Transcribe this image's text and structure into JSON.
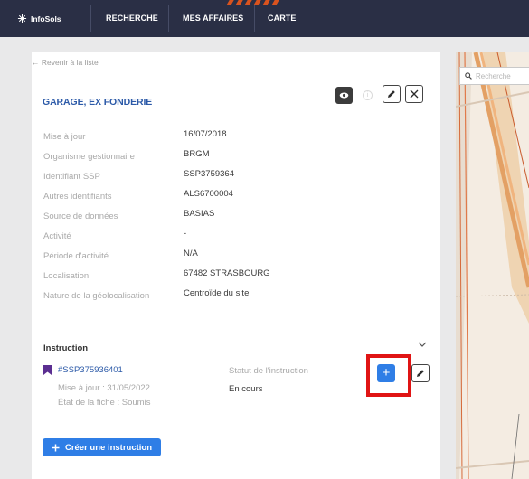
{
  "nav": {
    "logo": "InfoSols",
    "items": [
      "RECHERCHE",
      "MES AFFAIRES",
      "CARTE"
    ]
  },
  "panel": {
    "back": "← Revenir à la liste",
    "title": "GARAGE, EX FONDERIE",
    "fields": [
      {
        "label": "Mise à jour",
        "value": "16/07/2018"
      },
      {
        "label": "Organisme gestionnaire",
        "value": "BRGM"
      },
      {
        "label": "Identifiant SSP",
        "value": "SSP3759364"
      },
      {
        "label": "Autres identifiants",
        "value": "ALS6700004"
      },
      {
        "label": "Source de données",
        "value": "BASIAS"
      },
      {
        "label": "Activité",
        "value": "-"
      },
      {
        "label": "Période d'activité",
        "value": "N/A"
      },
      {
        "label": "Localisation",
        "value": "67482 STRASBOURG"
      },
      {
        "label": "Nature de la géolocalisation",
        "value": "Centroïde du site"
      }
    ]
  },
  "instruction": {
    "section_title": "Instruction",
    "id": "#SSP375936401",
    "updated": "Mise à jour : 31/05/2022",
    "state": "État de la fiche : Soumis",
    "status_label": "Statut de l'instruction",
    "status_value": "En cours",
    "add_label": "+",
    "create_label": "Créer une instruction"
  },
  "map": {
    "search_placeholder": "Recherche"
  },
  "colors": {
    "nav_bg": "#2a2f45",
    "accent_blue": "#2f7ee6",
    "title_blue": "#2c5aa8",
    "bookmark_purple": "#5b2e91",
    "highlight_red": "#e01414"
  }
}
